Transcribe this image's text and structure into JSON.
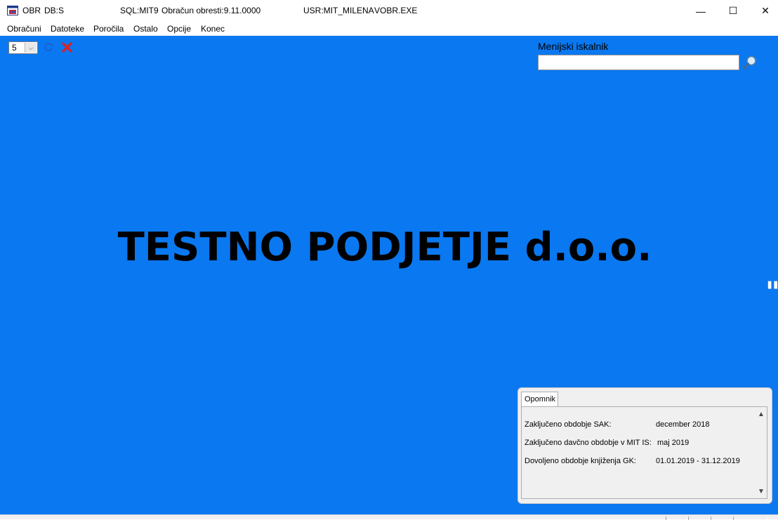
{
  "titlebar": {
    "app": "OBR",
    "db": "DB:S",
    "sql": "SQL:MIT9",
    "module": "Obračun obresti:9.11.0000",
    "user": "USR:MIT_MILENA",
    "exe": "VOBR.EXE",
    "minimize": "—",
    "maximize": "☐",
    "close": "✕"
  },
  "menu": {
    "items": [
      "Obračuni",
      "Datoteke",
      "Poročila",
      "Ostalo",
      "Opcije",
      "Konec"
    ]
  },
  "toolbar": {
    "combo_value": "5",
    "combo_arrow": "⌵"
  },
  "search": {
    "label": "Menijski iskalnik",
    "value": "",
    "placeholder": ""
  },
  "main": {
    "company": "TESTNO PODJETJE d.o.o.",
    "edge_glyph": "\""
  },
  "panel": {
    "tab": "Opomnik",
    "rows": [
      {
        "label": "Zaključeno obdobje SAK:",
        "value": "december  2018"
      },
      {
        "label": "Zaključeno davčno obdobje v MIT IS:",
        "value": "maj  2019"
      },
      {
        "label": "Dovoljeno obdobje knjiženja GK:",
        "value": "01.01.2019 - 31.12.2019"
      }
    ],
    "scroll_up": "▲",
    "scroll_down": "▼"
  },
  "colors": {
    "background": "#0a78f0",
    "panel": "#f0f0f0",
    "cancel_red": "#e02020"
  },
  "icons": [
    "app-icon",
    "refresh-icon",
    "close-icon",
    "search-icon",
    "chevron-down-icon"
  ]
}
